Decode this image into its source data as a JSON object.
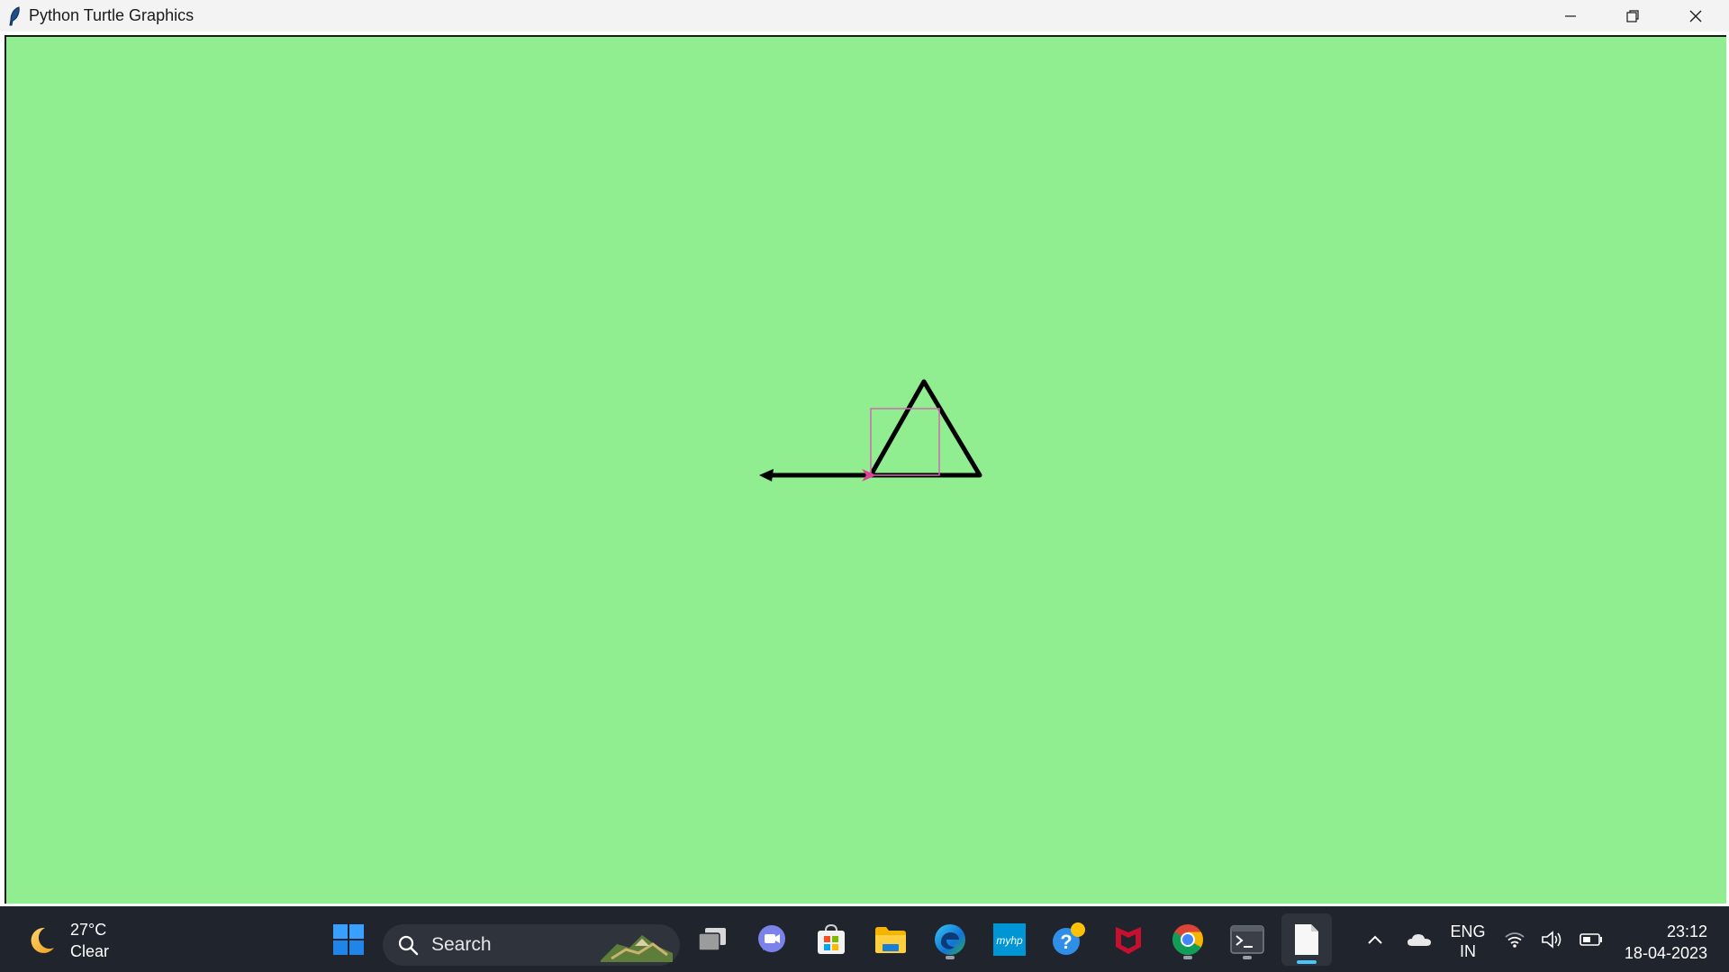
{
  "window": {
    "title": "Python Turtle Graphics",
    "controls": [
      "minimize",
      "restore",
      "close"
    ]
  },
  "canvas": {
    "background_color": "#90ee90",
    "drawing": {
      "pen_color": "#000000",
      "turtle_color": "#e0409a",
      "selection_box_color": "#d06bb0",
      "shapes": [
        "triangle",
        "line-with-arrow",
        "turtle-cursor",
        "selection-box"
      ]
    }
  },
  "taskbar": {
    "weather": {
      "temperature": "27°C",
      "condition": "Clear",
      "icon": "moon-icon"
    },
    "search": {
      "placeholder": "Search"
    },
    "apps": [
      {
        "name": "start",
        "icon": "windows-icon"
      },
      {
        "name": "task-view",
        "icon": "task-view-icon"
      },
      {
        "name": "teams-chat",
        "icon": "chat-icon"
      },
      {
        "name": "microsoft-store",
        "icon": "store-icon"
      },
      {
        "name": "file-explorer",
        "icon": "folder-icon"
      },
      {
        "name": "edge",
        "icon": "edge-icon"
      },
      {
        "name": "myhp",
        "icon": "myhp-icon",
        "label": "myhp"
      },
      {
        "name": "get-help",
        "icon": "help-icon"
      },
      {
        "name": "mcafee",
        "icon": "mcafee-icon"
      },
      {
        "name": "chrome",
        "icon": "chrome-icon"
      },
      {
        "name": "terminal",
        "icon": "terminal-icon"
      },
      {
        "name": "file",
        "icon": "file-icon"
      }
    ],
    "tray": {
      "language_line1": "ENG",
      "language_line2": "IN",
      "time": "23:12",
      "date": "18-04-2023"
    }
  }
}
